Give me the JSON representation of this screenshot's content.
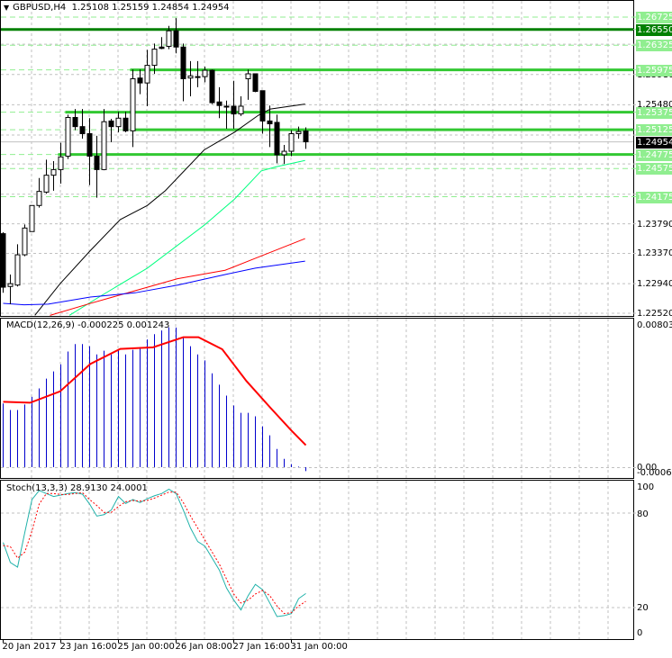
{
  "header": {
    "menu_icon": "triangle-down-icon",
    "symbol": "GBPUSD,H4",
    "ohlc": "1.25108 1.25159 1.24854 1.24954"
  },
  "colors": {
    "bull": "#ffffff",
    "bear": "#000000",
    "level_solid": "#32c832",
    "level_key": "#008000",
    "level_dashed": "#90ee90",
    "ma_black": "#000000",
    "ma_spring": "#00ff7f",
    "ma_red": "#ff0000",
    "ma_blue": "#0000ff",
    "macd_hist": "#0000cd",
    "macd_signal": "#ff0000",
    "stoch_main": "#20b2aa",
    "stoch_signal": "#ff0000"
  },
  "price_axis": {
    "labels": [
      "1.25910",
      "1.25480",
      "1.23790",
      "1.23370",
      "1.22940",
      "1.22520"
    ],
    "level_labels": [
      {
        "text": "1.26725",
        "kind": "dashed"
      },
      {
        "text": "1.26550",
        "kind": "key"
      },
      {
        "text": "1.26325",
        "kind": "dashed"
      },
      {
        "text": "1.25975",
        "kind": "solid"
      },
      {
        "text": "1.25375",
        "kind": "solid"
      },
      {
        "text": "1.25125",
        "kind": "solid"
      },
      {
        "text": "1.24775",
        "kind": "solid"
      },
      {
        "text": "1.24575",
        "kind": "dashed"
      },
      {
        "text": "1.24175",
        "kind": "dashed"
      }
    ],
    "current_price": "1.24954"
  },
  "time_axis": [
    "20 Jan 2017",
    "23 Jan 16:00",
    "25 Jan 00:00",
    "26 Jan 08:00",
    "27 Jan 16:00",
    "31 Jan 00:00"
  ],
  "chart_data": [
    {
      "type": "candlestick",
      "title": "GBPUSD,H4",
      "ylim": [
        1.2252,
        1.26725
      ],
      "grid": true,
      "candles_ohlc": [
        [
          1.2365,
          1.2367,
          1.2281,
          1.2289
        ],
        [
          1.229,
          1.2307,
          1.2265,
          1.2294
        ],
        [
          1.2292,
          1.235,
          1.229,
          1.2335
        ],
        [
          1.2335,
          1.2378,
          1.2333,
          1.2373
        ],
        [
          1.2368,
          1.2405,
          1.2368,
          1.2405
        ],
        [
          1.2405,
          1.2444,
          1.2402,
          1.2425
        ],
        [
          1.2424,
          1.247,
          1.2422,
          1.2448
        ],
        [
          1.2448,
          1.2468,
          1.2426,
          1.2456
        ],
        [
          1.2456,
          1.2494,
          1.2436,
          1.2474
        ],
        [
          1.2475,
          1.2534,
          1.2471,
          1.253
        ],
        [
          1.253,
          1.2542,
          1.2512,
          1.2517
        ],
        [
          1.2517,
          1.2542,
          1.25,
          1.2507
        ],
        [
          1.2507,
          1.2529,
          1.2434,
          1.2475
        ],
        [
          1.2475,
          1.2504,
          1.2416,
          1.2456
        ],
        [
          1.2456,
          1.2542,
          1.2455,
          1.2524
        ],
        [
          1.2525,
          1.2528,
          1.2495,
          1.2517
        ],
        [
          1.2517,
          1.2538,
          1.2509,
          1.2529
        ],
        [
          1.2529,
          1.2538,
          1.2509,
          1.2511
        ],
        [
          1.2511,
          1.2598,
          1.2488,
          1.2585
        ],
        [
          1.2586,
          1.2598,
          1.2563,
          1.2579
        ],
        [
          1.2579,
          1.2626,
          1.2546,
          1.2604
        ],
        [
          1.2604,
          1.2635,
          1.2592,
          1.2627
        ],
        [
          1.263,
          1.2644,
          1.2627,
          1.2628
        ],
        [
          1.2631,
          1.266,
          1.2627,
          1.2653
        ],
        [
          1.2653,
          1.2671,
          1.2621,
          1.263
        ],
        [
          1.263,
          1.2635,
          1.2553,
          1.2585
        ],
        [
          1.2586,
          1.261,
          1.256,
          1.2589
        ],
        [
          1.2588,
          1.261,
          1.2573,
          1.2587
        ],
        [
          1.2588,
          1.2602,
          1.258,
          1.2597
        ],
        [
          1.2597,
          1.2598,
          1.2549,
          1.2551
        ],
        [
          1.2552,
          1.2573,
          1.2529,
          1.2547
        ],
        [
          1.2546,
          1.2554,
          1.2514,
          1.2546
        ],
        [
          1.2546,
          1.2582,
          1.2514,
          1.2535
        ],
        [
          1.2535,
          1.256,
          1.2532,
          1.2546
        ],
        [
          1.2585,
          1.2598,
          1.2555,
          1.2592
        ],
        [
          1.2592,
          1.2592,
          1.2566,
          1.2567
        ],
        [
          1.2568,
          1.2568,
          1.2507,
          1.2525
        ],
        [
          1.2525,
          1.2547,
          1.2488,
          1.2521
        ],
        [
          1.2523,
          1.2534,
          1.2465,
          1.2477
        ],
        [
          1.2477,
          1.2491,
          1.2464,
          1.2482
        ],
        [
          1.2482,
          1.2512,
          1.2475,
          1.2507
        ],
        [
          1.2507,
          1.2517,
          1.25,
          1.251
        ],
        [
          1.25108,
          1.25159,
          1.24854,
          1.24954
        ]
      ],
      "moving_averages": [
        {
          "color": "#000000",
          "points": [
            [
              4.4,
              1.2249
            ],
            [
              7.9,
              1.2294
            ],
            [
              12.1,
              1.2341
            ],
            [
              16.25,
              1.2385
            ],
            [
              20,
              1.2405
            ],
            [
              22.5,
              1.2426
            ],
            [
              27.9,
              1.2484
            ],
            [
              32.1,
              1.2509
            ],
            [
              35.4,
              1.2533
            ],
            [
              37.1,
              1.2542
            ],
            [
              41.9,
              1.2549
            ]
          ]
        },
        {
          "color": "#00ff7f",
          "points": [
            [
              9.2,
              1.2249
            ],
            [
              13.3,
              1.2275
            ],
            [
              20,
              1.2316
            ],
            [
              27.9,
              1.2377
            ],
            [
              32.1,
              1.2414
            ],
            [
              35.8,
              1.2454
            ],
            [
              37.9,
              1.246
            ],
            [
              41.9,
              1.2469
            ]
          ]
        },
        {
          "color": "#ff0000",
          "points": [
            [
              6.5,
              1.2249
            ],
            [
              12.1,
              1.2266
            ],
            [
              18.3,
              1.2284
            ],
            [
              24.2,
              1.2301
            ],
            [
              30.8,
              1.2313
            ],
            [
              35,
              1.233
            ],
            [
              41.9,
              1.2358
            ]
          ]
        },
        {
          "color": "#0000ff",
          "points": [
            [
              0,
              1.2266
            ],
            [
              2.9,
              1.2264
            ],
            [
              6.25,
              1.2265
            ],
            [
              12.1,
              1.2275
            ],
            [
              18.3,
              1.2281
            ],
            [
              24.2,
              1.2292
            ],
            [
              30.8,
              1.2307
            ],
            [
              35,
              1.2316
            ],
            [
              41.9,
              1.2326
            ]
          ]
        }
      ],
      "levels": [
        {
          "price": 1.26725,
          "style": "dashed"
        },
        {
          "price": 1.2655,
          "style": "key",
          "from_candle": 0
        },
        {
          "price": 1.26325,
          "style": "dashed"
        },
        {
          "price": 1.25975,
          "style": "solid",
          "from_candle": 18
        },
        {
          "price": 1.25375,
          "style": "solid",
          "from_candle": 9
        },
        {
          "price": 1.25125,
          "style": "solid",
          "from_candle": 18
        },
        {
          "price": 1.24775,
          "style": "solid",
          "from_candle": 8
        },
        {
          "price": 1.24575,
          "style": "dashed"
        },
        {
          "price": 1.24175,
          "style": "dashed"
        }
      ],
      "current_price": 1.24954
    },
    {
      "type": "bar",
      "title": "MACD(12,26,9) -0.000225 0.001243",
      "ylim": [
        -0.000618,
        0.008033
      ],
      "axis_labels": [
        "0.008033",
        "0.00",
        "-0.000618"
      ],
      "histogram": [
        0.0036,
        0.00323,
        0.00323,
        0.00354,
        0.00397,
        0.00445,
        0.005,
        0.00541,
        0.00581,
        0.00653,
        0.00695,
        0.00695,
        0.00683,
        0.00637,
        0.00658,
        0.00637,
        0.00663,
        0.00637,
        0.00663,
        0.00678,
        0.00721,
        0.00751,
        0.00772,
        0.0079,
        0.00789,
        0.00734,
        0.00683,
        0.00637,
        0.00603,
        0.0053,
        0.00466,
        0.00404,
        0.00348,
        0.00307,
        0.00307,
        0.00287,
        0.00231,
        0.0018,
        0.00103,
        0.00047,
        0.00017,
        3e-05,
        -0.000225
      ],
      "signal": [
        [
          0,
          0.00369
        ],
        [
          3.75,
          0.00364
        ],
        [
          7.9,
          0.00428
        ],
        [
          12.1,
          0.00583
        ],
        [
          16.25,
          0.00668
        ],
        [
          20.8,
          0.00677
        ],
        [
          25,
          0.00734
        ],
        [
          27.1,
          0.00734
        ],
        [
          30.4,
          0.00666
        ],
        [
          33.75,
          0.00487
        ],
        [
          37.1,
          0.00335
        ],
        [
          40,
          0.00207
        ],
        [
          42,
          0.001243
        ]
      ]
    },
    {
      "type": "line",
      "title": "Stoch(13,3,3) 28.9130 24.0001",
      "ylim": [
        0,
        100
      ],
      "axis_labels": [
        "100",
        "80",
        "20",
        "0"
      ],
      "main": [
        61.3,
        48.6,
        45.7,
        67.6,
        88.6,
        94.3,
        92.4,
        90.5,
        91.4,
        92.4,
        93.0,
        92.0,
        85.7,
        78.1,
        79.0,
        81.9,
        90.5,
        86.1,
        88.6,
        86.7,
        89.1,
        91.0,
        92.4,
        95.2,
        92.4,
        81.9,
        70.5,
        61.9,
        59.0,
        51.4,
        43.8,
        32.4,
        24.8,
        18.5,
        27.6,
        34.7,
        31.4,
        22.9,
        14.3,
        14.9,
        16.2,
        25.7,
        28.913
      ],
      "signal": [
        59.4,
        58.7,
        51.4,
        55.2,
        68.6,
        85.7,
        92.4,
        92.4,
        91.8,
        91.8,
        92.4,
        93.0,
        88.6,
        84.8,
        80.4,
        80.4,
        84.2,
        87.2,
        88.0,
        87.6,
        88.0,
        89.5,
        91.4,
        93.3,
        93.3,
        86.7,
        78.1,
        70.5,
        62.9,
        55.2,
        47.6,
        38.1,
        28.6,
        22.9,
        24.8,
        28.6,
        30.9,
        27.6,
        21.0,
        16.2,
        16.8,
        21.0,
        24.0001
      ]
    }
  ]
}
